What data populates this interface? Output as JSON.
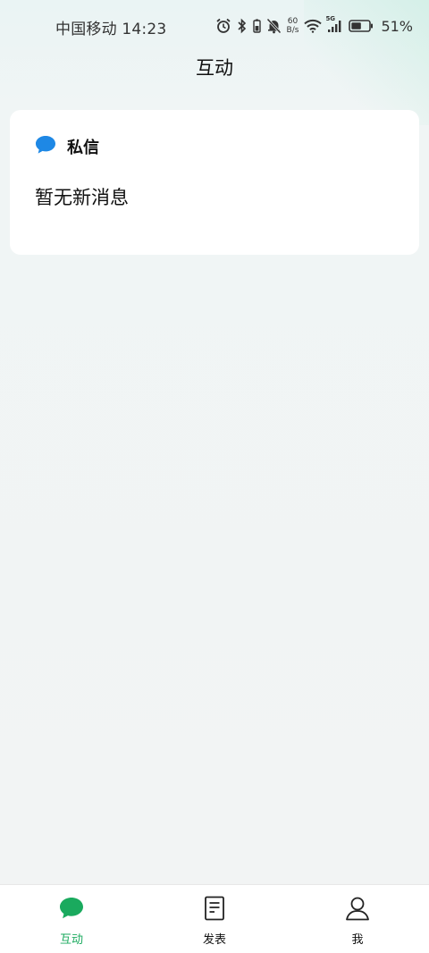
{
  "status_bar": {
    "carrier_time": "中国移动 14:23",
    "net_speed_value": "60",
    "net_speed_unit": "B/s",
    "signal_label": "5G",
    "battery_percent": "51%"
  },
  "header": {
    "title": "互动"
  },
  "messages_card": {
    "title": "私信",
    "empty_text": "暂无新消息",
    "icon": "chat-bubble-icon",
    "icon_color": "#1e88e5"
  },
  "bottom_nav": {
    "active_color": "#1aaa5e",
    "items": [
      {
        "label": "互动",
        "icon": "chat-bubble-icon",
        "active": true
      },
      {
        "label": "发表",
        "icon": "document-icon",
        "active": false
      },
      {
        "label": "我",
        "icon": "person-icon",
        "active": false
      }
    ]
  }
}
